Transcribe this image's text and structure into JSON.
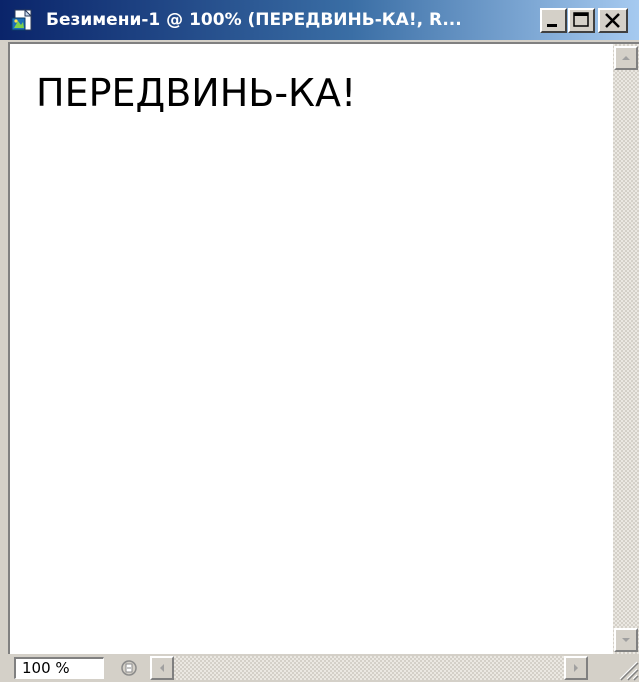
{
  "window": {
    "title": "Безимени-1 @ 100% (ПЕРЕДВИНЬ-КА!, R...",
    "icon": "fireworks-document-icon",
    "title_gradient": [
      "#0a246a",
      "#a6caf0"
    ]
  },
  "canvas": {
    "text": "ПЕРЕДВИНЬ-КА!",
    "background": "#ffffff"
  },
  "statusbar": {
    "zoom": "100 %"
  }
}
